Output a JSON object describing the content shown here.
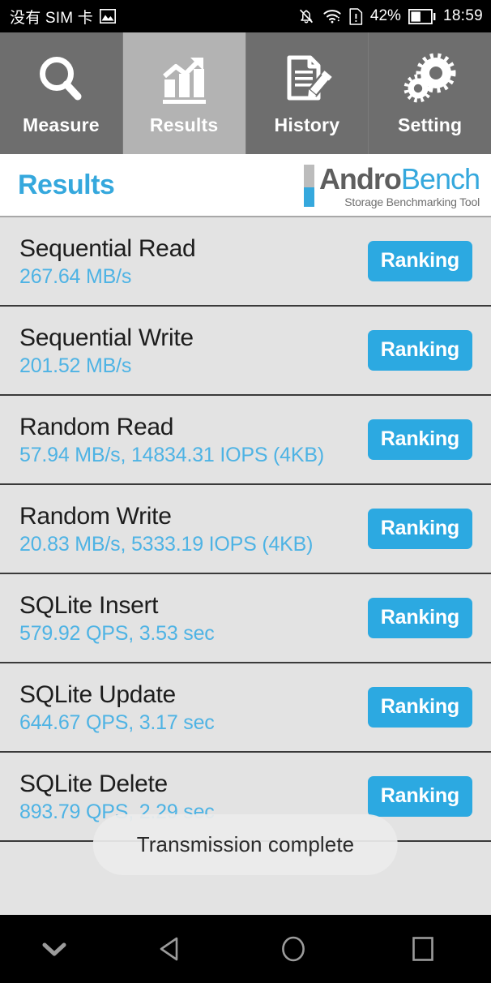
{
  "statusbar": {
    "carrier": "没有 SIM 卡",
    "icons_left": [
      "image-icon"
    ],
    "icons_right": [
      "notifications-off-icon",
      "wifi-icon",
      "warning-document-icon"
    ],
    "battery_percent": "42%",
    "time": "18:59"
  },
  "tabs": [
    {
      "label": "Measure",
      "icon": "magnifier-icon",
      "active": false
    },
    {
      "label": "Results",
      "icon": "bar-chart-arrow-icon",
      "active": true
    },
    {
      "label": "History",
      "icon": "document-pencil-icon",
      "active": false
    },
    {
      "label": "Setting",
      "icon": "gears-icon",
      "active": false
    }
  ],
  "header": {
    "title": "Results",
    "logo_primary": "Andro",
    "logo_secondary": "Bench",
    "logo_tagline": "Storage Benchmarking Tool"
  },
  "results": [
    {
      "name": "Sequential Read",
      "value": "267.64 MB/s",
      "button": "Ranking"
    },
    {
      "name": "Sequential Write",
      "value": "201.52 MB/s",
      "button": "Ranking"
    },
    {
      "name": "Random Read",
      "value": "57.94 MB/s, 14834.31 IOPS (4KB)",
      "button": "Ranking"
    },
    {
      "name": "Random Write",
      "value": "20.83 MB/s, 5333.19 IOPS (4KB)",
      "button": "Ranking"
    },
    {
      "name": "SQLite Insert",
      "value": "579.92 QPS, 3.53 sec",
      "button": "Ranking"
    },
    {
      "name": "SQLite Update",
      "value": "644.67 QPS, 3.17 sec",
      "button": "Ranking"
    },
    {
      "name": "SQLite Delete",
      "value": "893.79 QPS, 2.29 sec",
      "button": "Ranking"
    }
  ],
  "toast": {
    "message": "Transmission complete"
  },
  "navbar": {
    "buttons": [
      {
        "name": "hide-keyboard",
        "icon": "chevron-down-icon"
      },
      {
        "name": "back",
        "icon": "triangle-back-icon"
      },
      {
        "name": "home",
        "icon": "circle-home-icon"
      },
      {
        "name": "recents",
        "icon": "square-recents-icon"
      }
    ]
  },
  "colors": {
    "accent_blue": "#2ca9e1",
    "value_blue": "#4eb3e4",
    "tabbar_inactive": "#6e6e6e",
    "tabbar_active": "#b3b3b3",
    "list_background": "#e3e3e3",
    "row_divider": "#3a3a3a"
  }
}
